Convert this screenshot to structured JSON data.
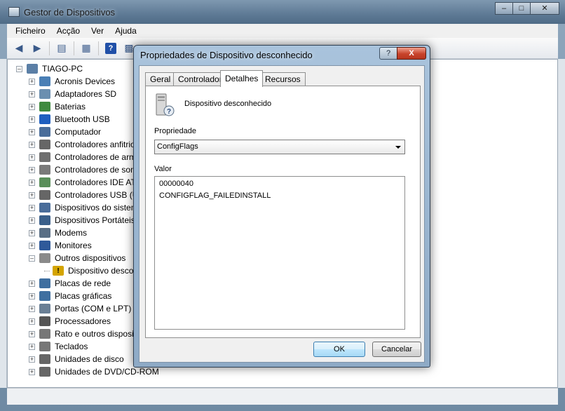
{
  "main": {
    "title": "Gestor de Dispositivos",
    "menu": [
      "Ficheiro",
      "Acção",
      "Ver",
      "Ajuda"
    ],
    "tree": {
      "root": "TIAGO-PC",
      "items": [
        {
          "label": "Acronis Devices",
          "icon": "disk-device-icon",
          "color": "#4a7fb5"
        },
        {
          "label": "Adaptadores SD",
          "icon": "sd-card-icon",
          "color": "#6b8fb0"
        },
        {
          "label": "Baterias",
          "icon": "battery-icon",
          "color": "#3f8a3f"
        },
        {
          "label": "Bluetooth USB",
          "icon": "bluetooth-icon",
          "color": "#1f5fbf"
        },
        {
          "label": "Computador",
          "icon": "computer-icon",
          "color": "#4a6d9a"
        },
        {
          "label": "Controladores anfitrio",
          "icon": "usb-controller-icon",
          "color": "#666666"
        },
        {
          "label": "Controladores de arm",
          "icon": "storage-controller-icon",
          "color": "#707070"
        },
        {
          "label": "Controladores de som",
          "icon": "speaker-icon",
          "color": "#7a7a7a"
        },
        {
          "label": "Controladores IDE AT",
          "icon": "ide-controller-icon",
          "color": "#5a8f5a"
        },
        {
          "label": "Controladores USB (U",
          "icon": "usb-icon",
          "color": "#666666"
        },
        {
          "label": "Dispositivos do sistem",
          "icon": "system-device-icon",
          "color": "#4a6d9a"
        },
        {
          "label": "Dispositivos Portáteis",
          "icon": "portable-device-icon",
          "color": "#3a5f8a"
        },
        {
          "label": "Modems",
          "icon": "modem-icon",
          "color": "#5a6f85"
        },
        {
          "label": "Monitores",
          "icon": "monitor-icon",
          "color": "#2f5a9a"
        },
        {
          "label": "Outros dispositivos",
          "icon": "unknown-device-icon",
          "color": "#8a8a8a"
        },
        {
          "label": "Dispositivo desco",
          "icon": "warning-device-icon",
          "color": "#d4a400"
        },
        {
          "label": "Placas de rede",
          "icon": "network-adapter-icon",
          "color": "#3f6fa0"
        },
        {
          "label": "Placas gráficas",
          "icon": "display-adapter-icon",
          "color": "#3f6fa0"
        },
        {
          "label": "Portas (COM e LPT)",
          "icon": "port-icon",
          "color": "#6a7f95"
        },
        {
          "label": "Processadores",
          "icon": "processor-icon",
          "color": "#555555"
        },
        {
          "label": "Rato e outros disposit",
          "icon": "mouse-icon",
          "color": "#777777"
        },
        {
          "label": "Teclados",
          "icon": "keyboard-icon",
          "color": "#777777"
        },
        {
          "label": "Unidades de disco",
          "icon": "disk-drive-icon",
          "color": "#666666"
        },
        {
          "label": "Unidades de DVD/CD-ROM",
          "icon": "dvd-drive-icon",
          "color": "#666666"
        }
      ]
    }
  },
  "dialog": {
    "title": "Propriedades de Dispositivo desconhecido",
    "help_glyph": "?",
    "close_glyph": "X",
    "tabs": [
      "Geral",
      "Controlador",
      "Detalhes",
      "Recursos"
    ],
    "active_tab": "Detalhes",
    "device_name": "Dispositivo desconhecido",
    "property_label": "Propriedade",
    "property_value": "ConfigFlags",
    "value_label": "Valor",
    "values": [
      "00000040",
      "CONFIGFLAG_FAILEDINSTALL"
    ],
    "ok_label": "OK",
    "cancel_label": "Cancelar"
  }
}
